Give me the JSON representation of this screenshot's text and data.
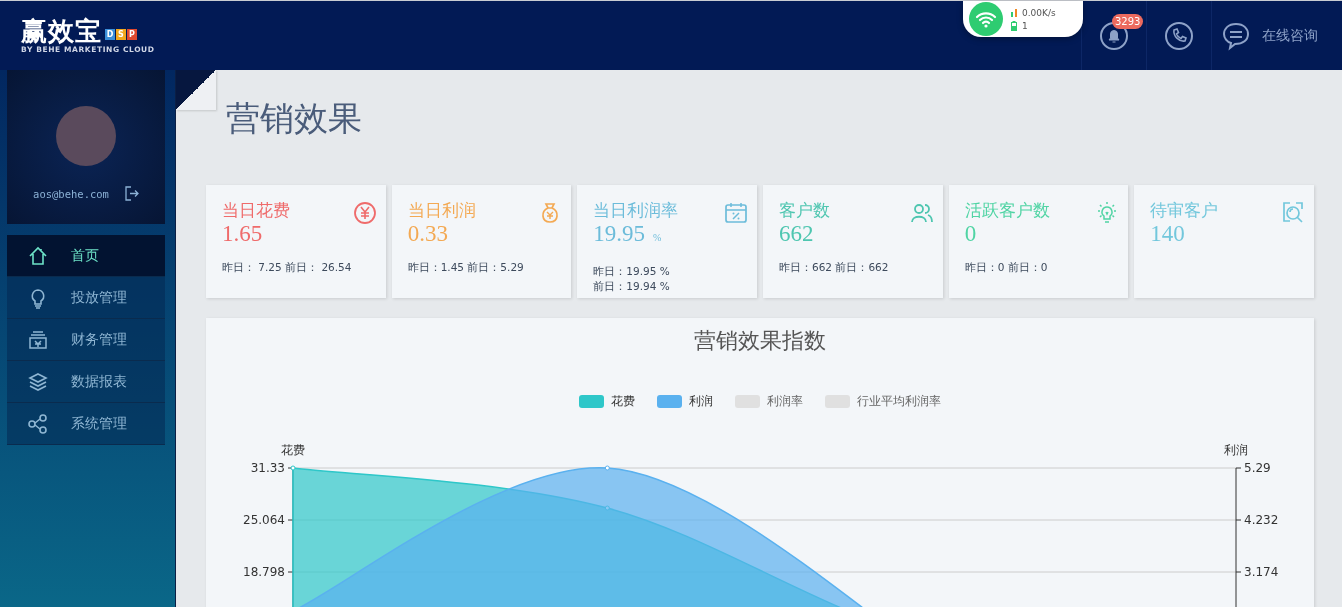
{
  "header": {
    "logo": {
      "name": "赢效宝",
      "letters": [
        {
          "text": "D",
          "color": "#3b8fd9"
        },
        {
          "text": "S",
          "color": "#f2a81d"
        },
        {
          "text": "P",
          "color": "#e0492f"
        }
      ],
      "tagline": "BY BEHE MARKETING CLOUD"
    },
    "network_popup": {
      "speed": "0.00K/s",
      "battery": "1"
    },
    "notifications": {
      "badge": "3293"
    },
    "consult_label": "在线咨询"
  },
  "sidebar": {
    "user": {
      "email": "aos@behe.com"
    },
    "items": [
      {
        "label": "首页",
        "kind": "home",
        "selected": true
      },
      {
        "label": "投放管理",
        "kind": "bulb",
        "selected": false
      },
      {
        "label": "财务管理",
        "kind": "register",
        "selected": false
      },
      {
        "label": "数据报表",
        "kind": "layers",
        "selected": false
      },
      {
        "label": "系统管理",
        "kind": "share",
        "selected": false
      }
    ]
  },
  "page": {
    "title": "营销效果"
  },
  "cards": [
    {
      "title": "当日花费",
      "value": "1.65",
      "color": "#ef6b6b",
      "kind": "yen",
      "footer": [
        "昨日： 7.25 前日： 26.54"
      ]
    },
    {
      "title": "当日利润",
      "value": "0.33",
      "color": "#f3a953",
      "kind": "bag",
      "footer": [
        "昨日：1.45 前日：5.29"
      ]
    },
    {
      "title": "当日利润率",
      "value": "19.95",
      "unit": "%",
      "color": "#6cbcda",
      "kind": "calendar",
      "footer": [
        "昨日：19.95 %",
        "前日：19.94 %"
      ]
    },
    {
      "title": "客户数",
      "value": "662",
      "color": "#4ec6b0",
      "kind": "users",
      "footer": [
        "昨日：662 前日：662"
      ]
    },
    {
      "title": "活跃客户数",
      "value": "0",
      "color": "#50d4a4",
      "kind": "bulb",
      "footer": [
        "昨日：0 前日：0"
      ]
    },
    {
      "title": "待审客户",
      "value": "140",
      "color": "#72c7dc",
      "kind": "search-doc"
    }
  ],
  "chart_panel": {
    "title": "营销效果指数",
    "legend": [
      {
        "label": "花费",
        "color": "#2ec7c9",
        "selected": true
      },
      {
        "label": "利润",
        "color": "#5ab1ef",
        "selected": true
      },
      {
        "label": "利润率",
        "selected": false
      },
      {
        "label": "行业平均利润率",
        "selected": false
      }
    ],
    "left_axis_name": "花费",
    "right_axis_name": "利润",
    "left_axis_ticks": [
      "31.33",
      "25.064",
      "18.798"
    ],
    "right_axis_ticks": [
      "5.29",
      "4.232",
      "3.174"
    ]
  }
}
